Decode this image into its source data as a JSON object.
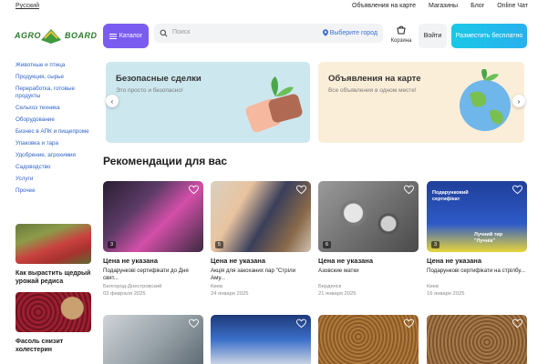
{
  "topbar": {
    "language": "Русский",
    "links": [
      "Объявления на карте",
      "Магазины",
      "Блог",
      "Online Чат"
    ]
  },
  "header": {
    "logo_left": "AGRO",
    "logo_right": "BOARD",
    "catalog_label": "Каталог",
    "search_placeholder": "Поиск",
    "city_label": "Выберите город",
    "cart_label": "Корзина",
    "login_label": "Войти",
    "post_label": "Разместить бесплатно"
  },
  "sidebar": {
    "items": [
      "Животные и птица",
      "Продукция, сырье",
      "Переработка, готовые продукты",
      "Сельхоз техника",
      "Оборудование",
      "Бизнес в АПК и пищепроме",
      "Упаковка и тара",
      "Удобрение, агрохимия",
      "Садоводство",
      "Услуги",
      "Прочее"
    ],
    "articles": [
      {
        "caption": "Как вырастить щедрый урожай редиса"
      },
      {
        "caption": "Фасоль снизит холестерин"
      }
    ]
  },
  "banners": [
    {
      "title": "Безопасные сделки",
      "subtitle": "Это просто и безопасно!"
    },
    {
      "title": "Объявления на карте",
      "subtitle": "Все объявления в одном месте!"
    }
  ],
  "recommendations": {
    "title": "Рекомендации для вас",
    "cards": [
      {
        "photo_count": "3",
        "price": "Цена не указана",
        "name": "Подарункові сертифікати до Дня свят...",
        "city": "Белгород-Днестровский",
        "date": "02 февраля 2025"
      },
      {
        "photo_count": "5",
        "price": "Цена не указана",
        "name": "Акція для закоханих пар \"Стріли Аму...",
        "city": "Киев",
        "date": "24 января 2025"
      },
      {
        "photo_count": "6",
        "price": "Цена не указана",
        "name": "Азовские матки",
        "city": "Бердянск",
        "date": "21 января 2025"
      },
      {
        "photo_count": "3",
        "price": "Цена не указана",
        "name": "Подарункові сертифікати на стрілбу...",
        "city": "Киев",
        "date": "16 января 2025"
      }
    ],
    "card4_overlay_top": "Подарунковий сертифікат",
    "card4_overlay_bottom": "Лучний тир \"Лучнік\""
  },
  "colors": {
    "accent_purple": "#7b5cf0",
    "accent_cyan": "#1ec3ea",
    "link_blue": "#2f63c8",
    "logo_green": "#2b7a2b"
  }
}
